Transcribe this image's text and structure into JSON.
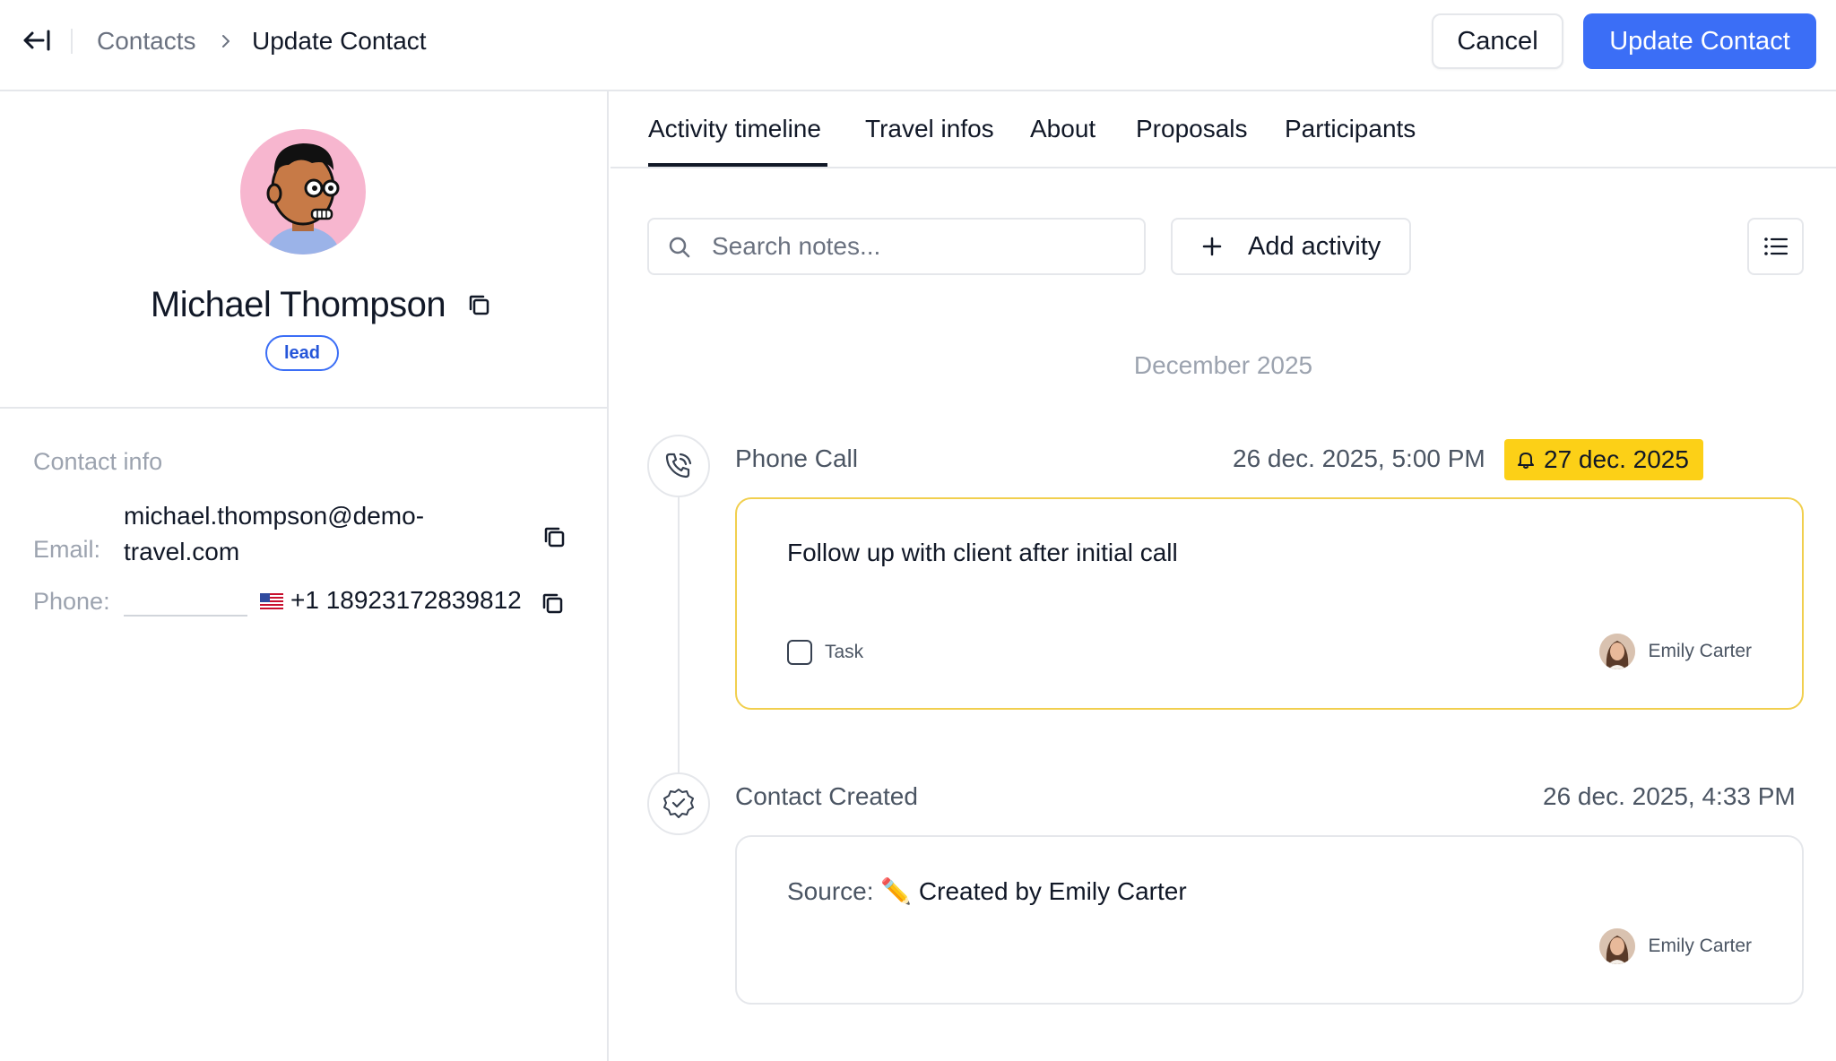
{
  "header": {
    "breadcrumb_root": "Contacts",
    "breadcrumb_current": "Update Contact",
    "cancel_label": "Cancel",
    "update_label": "Update Contact",
    "accent_color": "#3b6ef6"
  },
  "contact": {
    "name": "Michael Thompson",
    "status_badge": "lead",
    "info_title": "Contact info",
    "email_label": "Email:",
    "email_value": "michael.thompson@demo-travel.com",
    "phone_label": "Phone:",
    "phone_flag": "us-flag",
    "phone_value": "+1 18923172839812"
  },
  "tabs": [
    {
      "label": "Activity timeline",
      "active": true
    },
    {
      "label": "Travel infos",
      "active": false
    },
    {
      "label": "About",
      "active": false
    },
    {
      "label": "Proposals",
      "active": false
    },
    {
      "label": "Participants",
      "active": false
    }
  ],
  "toolbar": {
    "search_placeholder": "Search notes...",
    "add_activity_label": "Add activity"
  },
  "timeline": {
    "month": "December 2025",
    "activities": [
      {
        "type": "Phone Call",
        "icon": "phone-call-icon",
        "datetime": "26 dec. 2025, 5:00 PM",
        "reminder": "27 dec. 2025",
        "reminder_color": "#fcd017",
        "note": "Follow up with client after initial call",
        "task_label": "Task",
        "task_done": false,
        "author": "Emily Carter"
      },
      {
        "type": "Contact Created",
        "icon": "verified-badge-icon",
        "datetime": "26 dec. 2025, 4:33 PM",
        "source_label": "Source:",
        "source_value": "✏️ Created by Emily Carter",
        "author": "Emily Carter"
      }
    ]
  }
}
